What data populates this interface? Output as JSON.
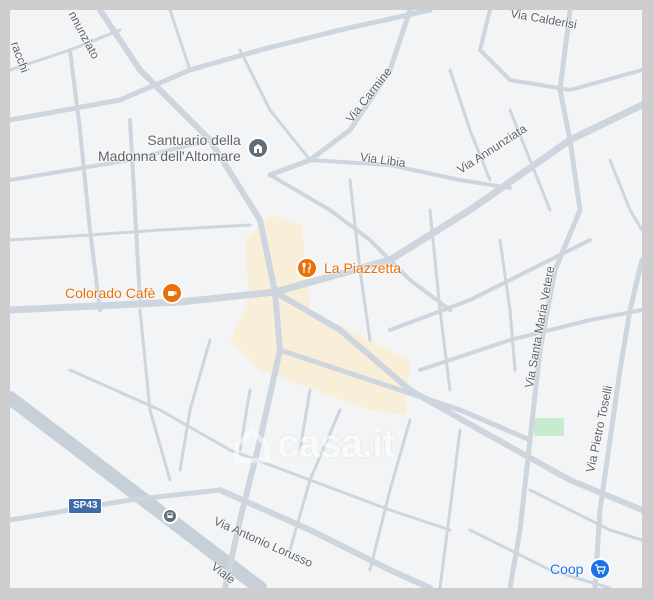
{
  "map": {
    "colors": {
      "background": "#f3f4f6",
      "road": "#cdd5de",
      "highlight_area": "#f9efd9",
      "park": "#c8ebcf",
      "poi_orange": "#e8710a",
      "poi_gray": "#5f6e7b",
      "shop_blue": "#1a73e8"
    },
    "street_labels": {
      "via_calderisi": "Via Calderisi",
      "via_carmine": "Via Carmine",
      "via_libia": "Via Libia",
      "via_annunziata": "Via Annunziata",
      "via_santa_maria_vetere": "Via Santa Maria Vetere",
      "via_pietro_toselli": "Via Pietro Toselli",
      "via_antonio_lorusso": "Via Antonio Lorusso",
      "viale": "Viale",
      "annunziato_partial": "nnunziato",
      "gracchi_partial": "racchi"
    },
    "road_shield": "SP43",
    "pois": {
      "santuario": {
        "name_line1": "Santuario della",
        "name_line2": "Madonna dell'Altomare",
        "icon": "church-icon"
      },
      "la_piazzetta": {
        "name": "La Piazzetta",
        "icon": "restaurant-icon"
      },
      "colorado_cafe": {
        "name": "Colorado Cafè",
        "icon": "coffee-cup-icon"
      },
      "coop": {
        "name": "Coop",
        "icon": "shopping-cart-icon"
      },
      "station": {
        "icon": "bus-stop-icon"
      }
    },
    "watermark": "casa.it"
  }
}
